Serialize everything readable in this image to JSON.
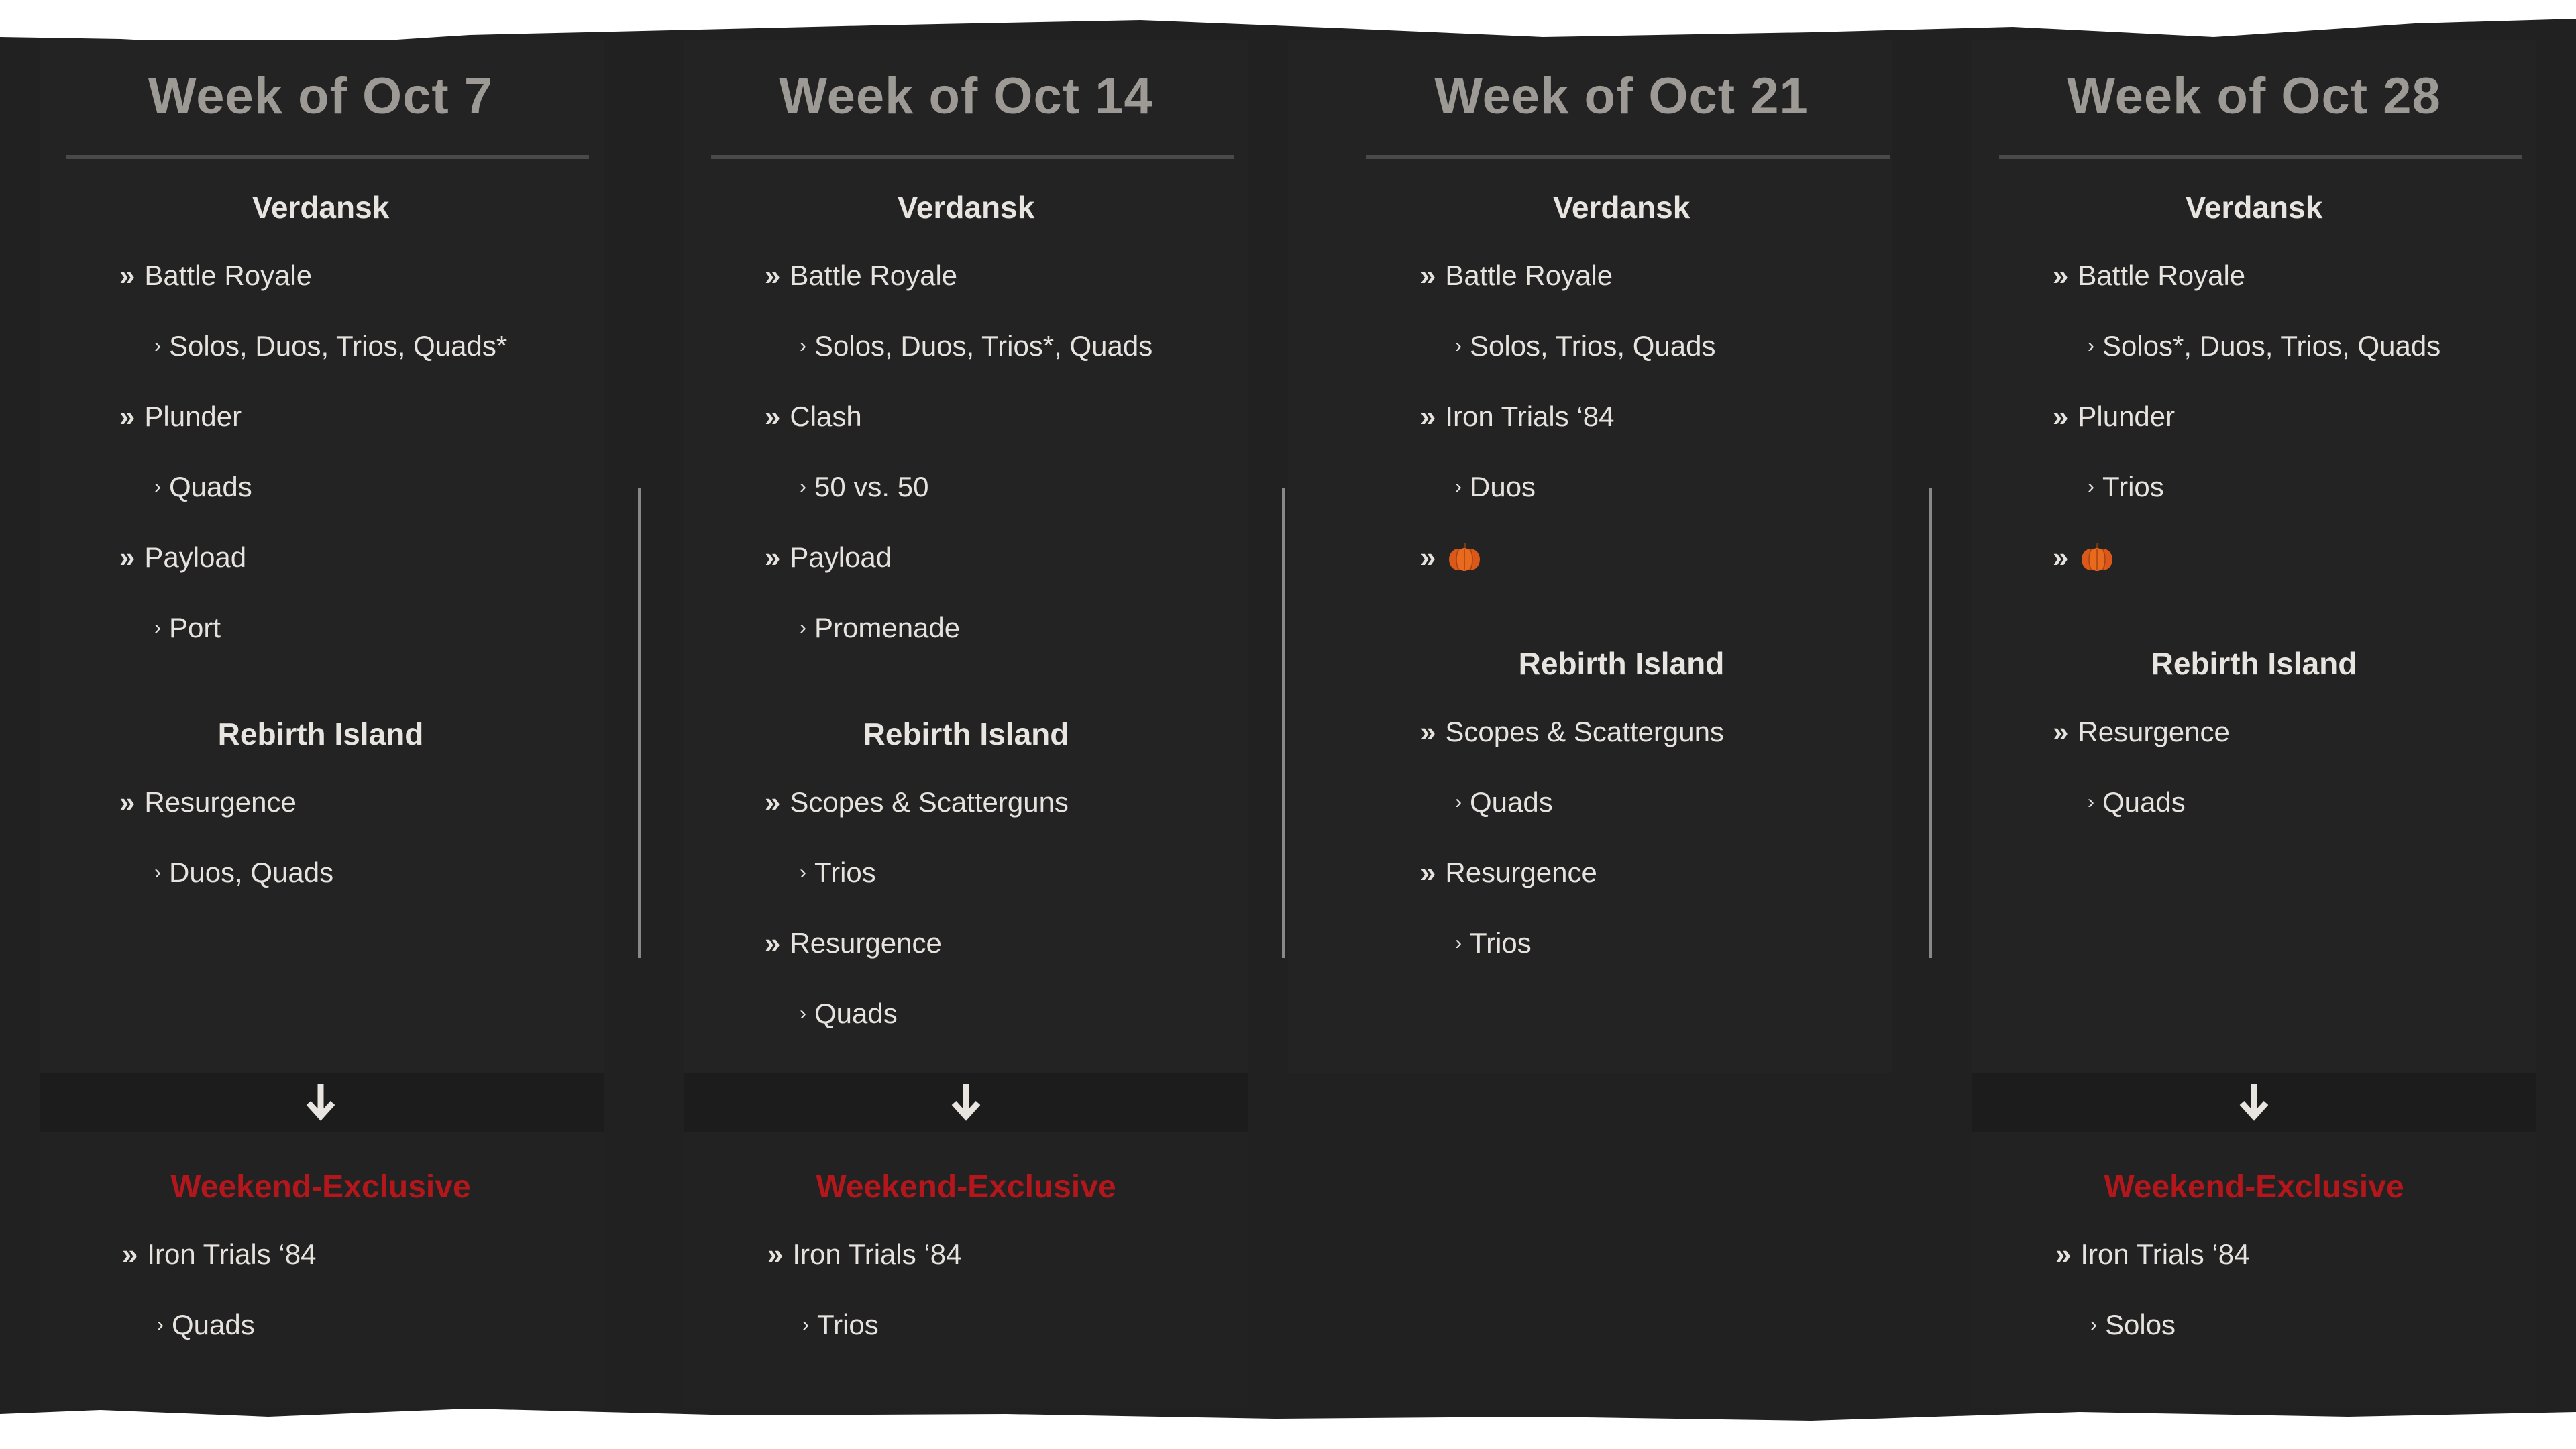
{
  "colors": {
    "accent_red": "#b4171b",
    "pumpkin": "#e0601a",
    "text": "#e6e3de",
    "header": "#9d9a96"
  },
  "weeks": [
    {
      "title": "Week of Oct 7",
      "verdansk": {
        "title": "Verdansk",
        "modes": [
          {
            "name": "Battle Royale",
            "sub": "Solos, Duos, Trios, Quads*"
          },
          {
            "name": "Plunder",
            "sub": "Quads"
          },
          {
            "name": "Payload",
            "sub": "Port"
          }
        ]
      },
      "rebirth": {
        "title": "Rebirth Island",
        "modes": [
          {
            "name": "Resurgence",
            "sub": "Duos, Quads"
          }
        ]
      },
      "weekend": {
        "title": "Weekend-Exclusive",
        "modes": [
          {
            "name": "Iron Trials ‘84",
            "sub": "Quads"
          }
        ]
      }
    },
    {
      "title": "Week of Oct 14",
      "verdansk": {
        "title": "Verdansk",
        "modes": [
          {
            "name": "Battle Royale",
            "sub": "Solos, Duos, Trios*, Quads"
          },
          {
            "name": "Clash",
            "sub": "50 vs. 50"
          },
          {
            "name": "Payload",
            "sub": "Promenade"
          }
        ]
      },
      "rebirth": {
        "title": "Rebirth Island",
        "modes": [
          {
            "name": "Scopes & Scatterguns",
            "sub": "Trios"
          },
          {
            "name": "Resurgence",
            "sub": "Quads"
          }
        ]
      },
      "weekend": {
        "title": "Weekend-Exclusive",
        "modes": [
          {
            "name": "Iron Trials ‘84",
            "sub": "Trios"
          }
        ]
      }
    },
    {
      "title": "Week of Oct 21",
      "verdansk": {
        "title": "Verdansk",
        "modes": [
          {
            "name": "Battle Royale",
            "sub": "Solos, Trios, Quads"
          },
          {
            "name": "Iron Trials ‘84",
            "sub": "Duos"
          },
          {
            "name": "pumpkin-icon",
            "icon": true
          }
        ]
      },
      "rebirth": {
        "title": "Rebirth Island",
        "modes": [
          {
            "name": "Scopes & Scatterguns",
            "sub": "Quads"
          },
          {
            "name": "Resurgence",
            "sub": "Trios"
          }
        ]
      }
    },
    {
      "title": "Week of Oct 28",
      "verdansk": {
        "title": "Verdansk",
        "modes": [
          {
            "name": "Battle Royale",
            "sub": "Solos*, Duos, Trios, Quads"
          },
          {
            "name": "Plunder",
            "sub": "Trios"
          },
          {
            "name": "pumpkin-icon",
            "icon": true
          }
        ]
      },
      "rebirth": {
        "title": "Rebirth Island",
        "modes": [
          {
            "name": "Resurgence",
            "sub": "Quads"
          }
        ]
      },
      "weekend": {
        "title": "Weekend-Exclusive",
        "modes": [
          {
            "name": "Iron Trials ‘84",
            "sub": "Solos"
          }
        ]
      }
    }
  ],
  "glyphs": {
    "double_chevron": "»",
    "single_chevron": "›"
  }
}
